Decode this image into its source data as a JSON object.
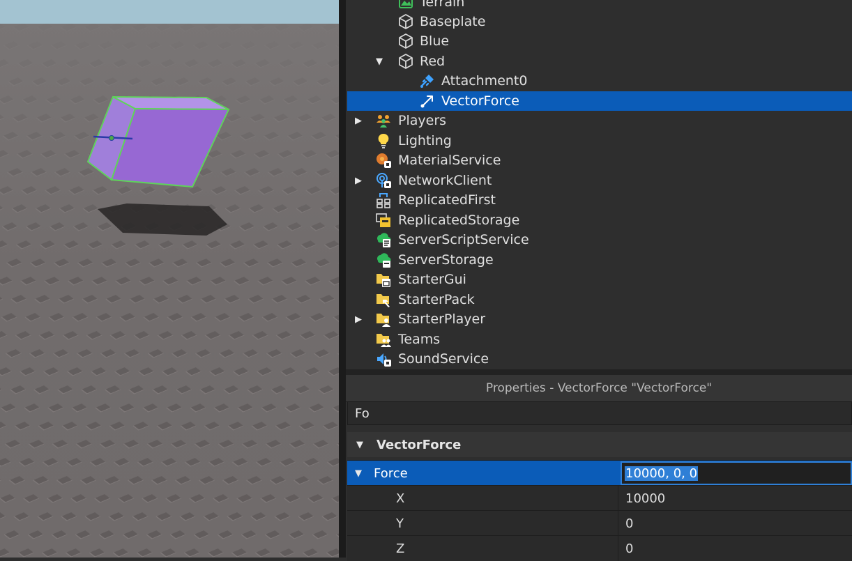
{
  "explorer": {
    "items": [
      {
        "label": "Terrain",
        "icon": "terrain-icon"
      },
      {
        "label": "Baseplate",
        "icon": "part-icon"
      },
      {
        "label": "Blue",
        "icon": "part-icon"
      },
      {
        "label": "Red",
        "icon": "part-icon",
        "expanded": true
      },
      {
        "label": "Attachment0",
        "icon": "attachment-icon"
      },
      {
        "label": "VectorForce",
        "icon": "vectorforce-icon",
        "selected": true
      },
      {
        "label": "Players",
        "icon": "players-icon",
        "collapsed": true
      },
      {
        "label": "Lighting",
        "icon": "lighting-icon"
      },
      {
        "label": "MaterialService",
        "icon": "material-service-icon"
      },
      {
        "label": "NetworkClient",
        "icon": "network-client-icon",
        "collapsed": true
      },
      {
        "label": "ReplicatedFirst",
        "icon": "replicated-first-icon"
      },
      {
        "label": "ReplicatedStorage",
        "icon": "replicated-storage-icon"
      },
      {
        "label": "ServerScriptService",
        "icon": "server-script-service-icon"
      },
      {
        "label": "ServerStorage",
        "icon": "server-storage-icon"
      },
      {
        "label": "StarterGui",
        "icon": "starter-gui-icon"
      },
      {
        "label": "StarterPack",
        "icon": "starter-pack-icon"
      },
      {
        "label": "StarterPlayer",
        "icon": "starter-player-icon",
        "collapsed": true
      },
      {
        "label": "Teams",
        "icon": "teams-icon"
      },
      {
        "label": "SoundService",
        "icon": "sound-service-icon"
      }
    ]
  },
  "properties": {
    "title": "Properties - VectorForce \"VectorForce\"",
    "filter_value": "Fo",
    "category": "VectorForce",
    "force": {
      "name": "Force",
      "value": "10000, 0, 0"
    },
    "components": [
      {
        "name": "X",
        "value": "10000"
      },
      {
        "name": "Y",
        "value": "0"
      },
      {
        "name": "Z",
        "value": "0"
      }
    ]
  },
  "colors": {
    "selection": "#0b5cb8",
    "part_color": "#9b6fd6",
    "selection_outline": "#5fd35a"
  }
}
